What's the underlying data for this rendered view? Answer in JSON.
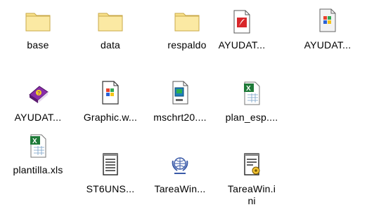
{
  "items": [
    {
      "label": "base",
      "icon": "folder-icon"
    },
    {
      "label": "data",
      "icon": "folder-icon"
    },
    {
      "label": "respaldo",
      "icon": "folder-icon"
    },
    {
      "label": "AYUDAT...",
      "icon": "acrobat-document-icon"
    },
    {
      "label": "AYUDAT...",
      "icon": "windows-help-document-icon"
    },
    {
      "label": "AYUDAT...",
      "icon": "help-book-icon"
    },
    {
      "label": "Graphic.w...",
      "icon": "windows-file-icon"
    },
    {
      "label": "mschrt20....",
      "icon": "ms-chart-file-icon"
    },
    {
      "label": "plan_esp....",
      "icon": "excel-spreadsheet-icon"
    },
    {
      "label": "plantilla.xls",
      "icon": "excel-spreadsheet-icon"
    },
    {
      "label": "ST6UNS...",
      "icon": "text-document-icon"
    },
    {
      "label": "TareaWin...",
      "icon": "globe-wreath-icon"
    },
    {
      "label": "TareaWin.i",
      "label_line2": "ni",
      "icon": "ini-settings-file-icon"
    }
  ]
}
